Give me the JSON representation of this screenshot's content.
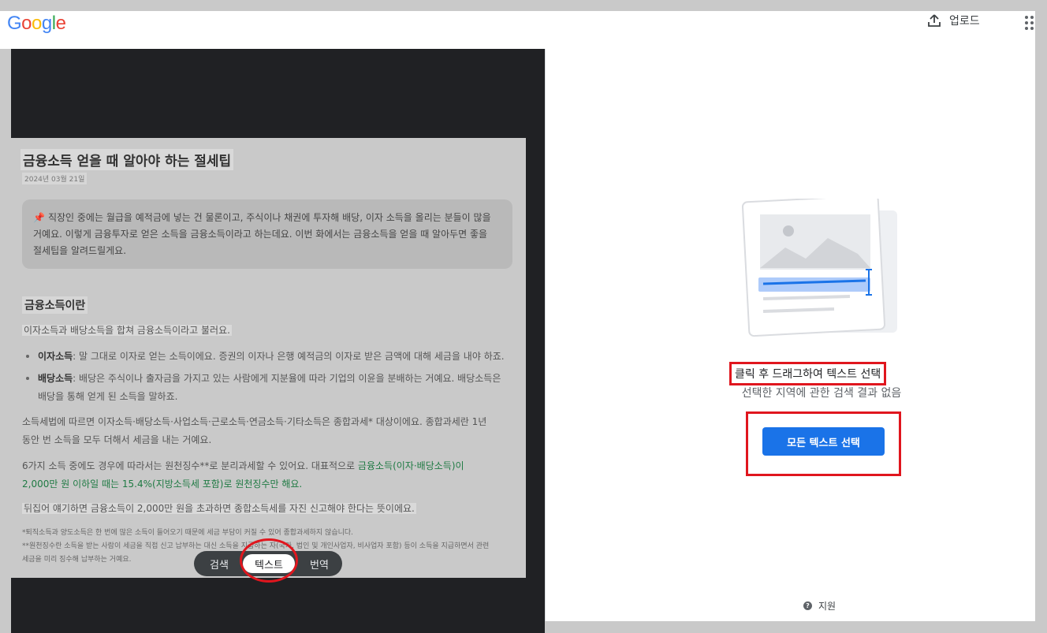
{
  "header": {
    "logo_letters": [
      "G",
      "o",
      "o",
      "g",
      "l",
      "e"
    ],
    "upload_label": "업로드"
  },
  "document": {
    "title": "금융소득 얻을 때 알아야 하는 절세팁",
    "date": "2024년 03월 21일",
    "intro_lines": [
      "직장인 중에는 월급을 예적금에 넣는 건 물론이고, 주식이나 채권에 투자해 배당, 이자 소득을 올리는 분들이 많을",
      "거예요. 이렇게 금융투자로 얻은 소득을 금융소득이라고 하는데요. 이번 화에서는 금융소득을 얻을 때 알아두면 좋을",
      "절세팁을 알려드릴게요."
    ],
    "heading": "금융소득이란",
    "p1": "이자소득과 배당소득을 합쳐 금융소득이라고 불러요.",
    "bullets": [
      {
        "term": "이자소득",
        "lines": [
          ": 말 그대로 이자로 얻는 소득이에요. 증권의 이자나 은행 예적금의 이자로 받은 금액에 대해 세금을 내야 하죠."
        ]
      },
      {
        "term": "배당소득",
        "lines": [
          ": 배당은 주식이나 출자금을 가지고 있는 사람에게 지분율에 따라 기업의 이윤을 분배하는 거예요. 배당소득은",
          "배당을 통해 얻게 된 소득을 말하죠."
        ]
      }
    ],
    "p2_lines": [
      "소득세법에 따르면 이자소득·배당소득·사업소득·근로소득·연금소득·기타소득은 종합과세* 대상이에요. 종합과세란 1년",
      "동안 번 소득을 모두 더해서 세금을 내는 거예요."
    ],
    "p3_line1_plain": "6가지 소득 중에도 경우에 따라서는 원천징수**로 분리과세할 수 있어요. 대표적으로 ",
    "p3_line1_green": "금융소득(이자·배당소득)이",
    "p3_line2_green": "2,000만 원 이하일 때는 15.4%(지방소득세 포함)로 원천징수만 해요.",
    "p4": "뒤집어 얘기하면 금융소득이 2,000만 원을 초과하면 종합소득세를 자진 신고해야 한다는 뜻이에요.",
    "notes": [
      "*퇴직소득과 양도소득은 한 번에 많은 소득이 들어오기 때문에 세금 부담이 커질 수 있어 종합과세하지 않습니다.",
      "**원천징수란 소득을 받는 사람이 세금을 직접 신고 납부하는 대신 소득을 지급하는 자(국가, 법인 및 개인사업자, 비사업자 포함) 등이 소득을 지급하면서 관련",
      "세금을 미리 징수해 납부하는 거예요."
    ]
  },
  "mode_chips": {
    "search": "검색",
    "text": "텍스트",
    "translate": "번역",
    "active": "text"
  },
  "panel": {
    "instruction": "클릭 후 드래그하여 텍스트 선택",
    "no_results": "선택한 지역에 관한 검색 결과 없음",
    "select_all_button": "모든 텍스트 선택",
    "help_label": "지원"
  },
  "colors": {
    "google_blue": "#4285f4",
    "google_red": "#ea4335",
    "google_yellow": "#fbbc05",
    "google_green": "#34a853",
    "accent_button": "#1a73e8",
    "annotation_red": "#e0161e",
    "highlight_green": "#1f7a43"
  },
  "icons": [
    "upload-icon",
    "apps-grid-icon",
    "pin-icon",
    "help-icon",
    "image-text-illustration"
  ]
}
